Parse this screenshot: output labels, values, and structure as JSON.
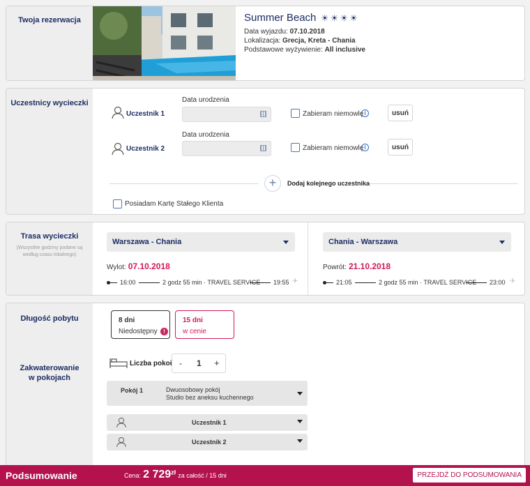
{
  "reservation": {
    "side_title": "Twoja rezerwacja",
    "hotel_name": "Summer Beach",
    "stars": [
      "☀",
      "☀",
      "☀",
      "☀"
    ],
    "departure_label": "Data wyjazdu:",
    "departure_value": "07.10.2018",
    "location_label": "Lokalizacja:",
    "location_value": "Grecja, Kreta - Chania",
    "board_label": "Podstawowe wyżywienie:",
    "board_value": "All inclusive"
  },
  "participants": {
    "side_title": "Uczestnicy wycieczki",
    "rows": [
      {
        "name": "Uczestnik 1",
        "date_label": "Data urodzenia",
        "infant_label": "Zabieram niemowlę",
        "remove_label": "usuń"
      },
      {
        "name": "Uczestnik 2",
        "date_label": "Data urodzenia",
        "infant_label": "Zabieram niemowlę",
        "remove_label": "usuń"
      }
    ],
    "add_label": "Dodaj kolejnego uczestnika",
    "loyalty_label": "Posiadam Kartę Stałego Klienta"
  },
  "route": {
    "side_title": "Trasa wycieczki",
    "side_note": "(Wszystkie godziny podane są według czasu lokalnego)",
    "outbound": {
      "select": "Warszawa - Chania",
      "date_label": "Wylot:",
      "date": "07.10.2018",
      "dep_time": "16:00",
      "info": "2 godz 55 min · TRAVEL SERVICE",
      "arr_time": "19:55"
    },
    "inbound": {
      "select": "Chania - Warszawa",
      "date_label": "Powrót:",
      "date": "21.10.2018",
      "dep_time": "21:05",
      "info": "2 godz 55 min · TRAVEL SERVICE",
      "arr_time": "23:00"
    }
  },
  "stay": {
    "side_title": "Długość pobytu",
    "options": [
      {
        "days": "8 dni",
        "status": "Niedostępny"
      },
      {
        "days": "15 dni",
        "status": "w cenie"
      }
    ],
    "accommodation_title": "Zakwaterowanie w pokojach",
    "rooms_label": "Liczba pokoi",
    "rooms_count": "1",
    "minus": "-",
    "plus": "+",
    "room_label": "Pokój 1",
    "room_type_line1": "Dwuosobowy pokój",
    "room_type_line2": "Studio bez aneksu kuchennego",
    "room_participants": [
      "Uczestnik 1",
      "Uczestnik 2"
    ]
  },
  "footer": {
    "title": "Podsumowanie",
    "price_prefix": "Cena:",
    "price": "2 729",
    "currency": "zł",
    "price_suffix": "za całość / 15 dni",
    "cta": "PRZEJDŹ DO PODSUMOWANIA"
  }
}
